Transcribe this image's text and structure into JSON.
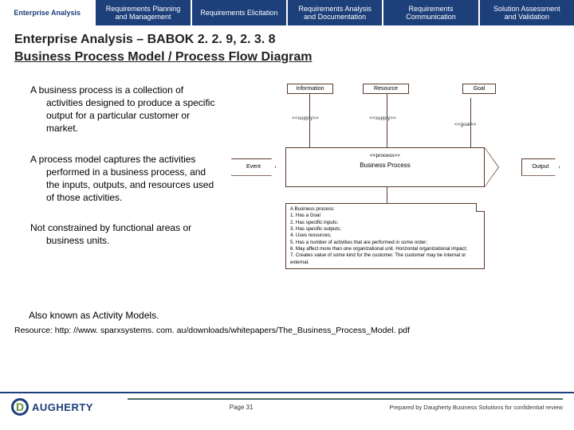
{
  "tabs": {
    "t0": "Enterprise Analysis",
    "t1": "Requirements Planning\nand Management",
    "t2": "Requirements Elicitation",
    "t3": "Requirements Analysis\nand Documentation",
    "t4": "Requirements\nCommunication",
    "t5": "Solution Assessment\nand Validation"
  },
  "title_line1": "Enterprise Analysis – BABOK 2. 2. 9, 2. 3. 8",
  "title_line2": "Business Process Model / Process Flow Diagram",
  "paragraphs": {
    "p1": "A business process is a collection of activities designed to produce a specific output for a particular customer or market.",
    "p2": "A process model captures the activities performed in a business process, and the inputs, outputs, and resources used of those activities.",
    "p3": "Not constrained by functional areas or business units.",
    "p4": "Also known as Activity Models."
  },
  "diagram": {
    "information": "Information",
    "resource": "Resource",
    "goal": "Goal",
    "supply1": "<<supply>>",
    "supply2": "<<supply>>",
    "goal_s": "<<goal>>",
    "event": "Event",
    "process_s": "<<process>>",
    "process": "Business Process",
    "output": "Output",
    "notes_title": "A Business process:",
    "n1": "1.  Has a Goal",
    "n2": "2.  Has specific inputs;",
    "n3": "3.  Has specific outputs;",
    "n4": "4.  Uses resources;",
    "n5": "5.  Has a number of activities that are performed in some order;",
    "n6": "6.  May affect more than one organizational unit. Horizontal organizational impact;",
    "n7": "7.  Creates value of some kind for the customer. The customer may be internal or external."
  },
  "resource_label": "Resource:  http: //www. sparxsystems. com. au/downloads/whitepapers/The_Business_Process_Model. pdf",
  "footer": {
    "logo_letter": "D",
    "logo_text": "AUGHERTY",
    "page": "Page 31",
    "prepared": "Prepared by Daugherty Business Solutions for confidential review"
  }
}
